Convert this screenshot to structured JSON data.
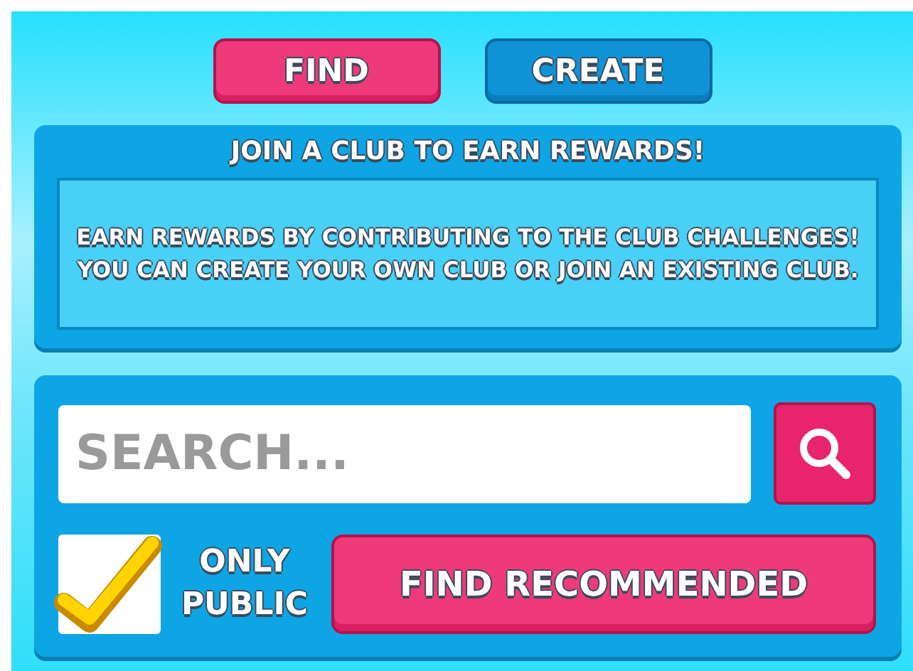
{
  "tabs": [
    {
      "label": "FIND",
      "selected": true
    },
    {
      "label": "CREATE",
      "selected": false
    }
  ],
  "info": {
    "title": "JOIN A CLUB TO EARN REWARDS!",
    "body": "EARN REWARDS BY CONTRIBUTING TO THE CLUB CHALLENGES! YOU CAN CREATE YOUR OWN CLUB OR JOIN AN EXISTING CLUB."
  },
  "search": {
    "placeholder": "SEARCH..."
  },
  "only_public": {
    "label": "ONLY PUBLIC",
    "checked": true
  },
  "find_recommended_button": "FIND RECOMMENDED"
}
